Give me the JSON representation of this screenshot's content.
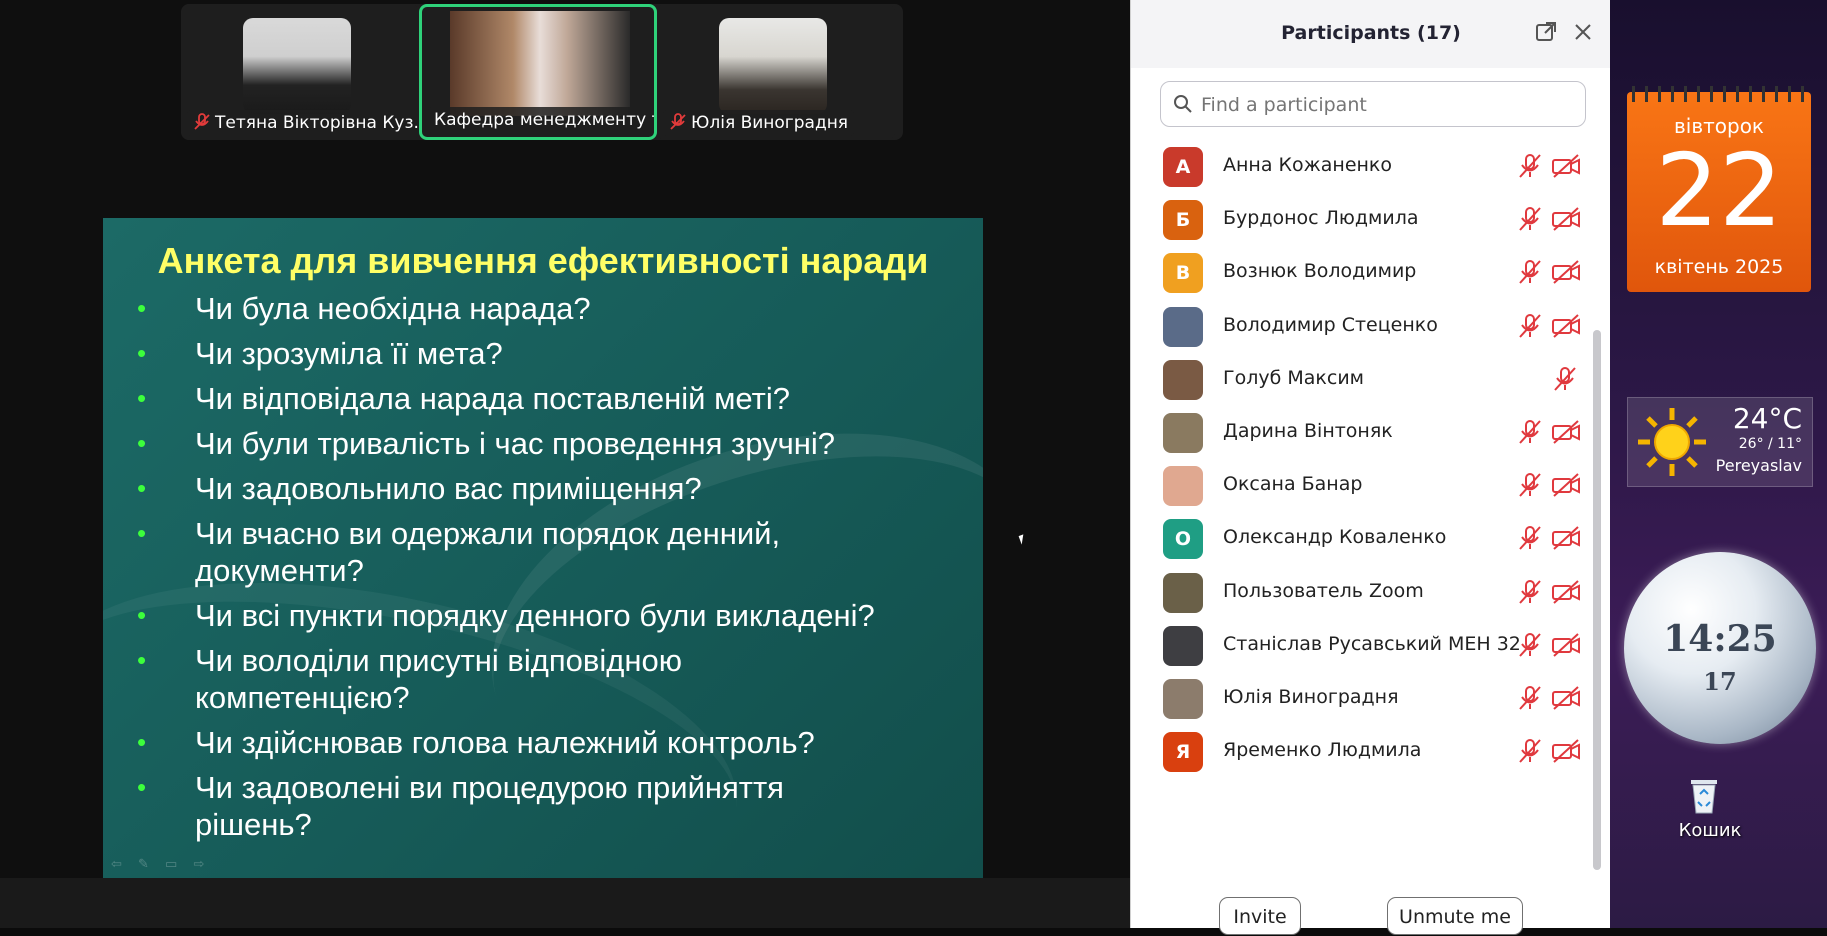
{
  "video_strip": {
    "tiles": [
      {
        "name": "Тетяна Вікторівна Куз...",
        "muted": true
      },
      {
        "name": "Кафедра менеджменту т...",
        "muted": false,
        "active_speaker": true
      },
      {
        "name": "Юлія Виноградня",
        "muted": true
      }
    ]
  },
  "slide": {
    "title": "Анкета для вивчення ефективності наради",
    "bullets": [
      "Чи була необхідна нарада?",
      "Чи зрозуміла її мета?",
      "Чи відповідала нарада поставленій меті?",
      "Чи були тривалість і час проведення зручні?",
      "Чи задовольнило вас приміщення?",
      "Чи вчасно ви одержали порядок денний, документи?",
      "Чи всі пункти порядку денного були викладені?",
      "Чи володіли присутні відповідною компетенцією?",
      "Чи здійснював голова належний контроль?",
      "Чи задоволені ви процедурою прийняття рішень?"
    ]
  },
  "participants": {
    "title": "Participants (17)",
    "search_placeholder": "Find a participant",
    "list": [
      {
        "name": "Анна Кожаненко",
        "initial": "А",
        "color": "#c93a2b",
        "mic_muted": true,
        "video_off": true
      },
      {
        "name": "Бурдонос Людмила",
        "initial": "Б",
        "color": "#d9620f",
        "mic_muted": true,
        "video_off": true
      },
      {
        "name": "Вознюк Володимир",
        "initial": "В",
        "color": "#f0a020",
        "mic_muted": true,
        "video_off": true
      },
      {
        "name": "Володимир Стеценко",
        "initial": "",
        "color": "#5a6b88",
        "mic_muted": true,
        "video_off": true
      },
      {
        "name": "Голуб Максим",
        "initial": "",
        "color": "#7a5a44",
        "mic_muted": true,
        "video_off": false
      },
      {
        "name": "Дарина Вінтоняк",
        "initial": "",
        "color": "#8a7a60",
        "mic_muted": true,
        "video_off": true
      },
      {
        "name": "Оксана Банар",
        "initial": "",
        "color": "#e0a890",
        "mic_muted": true,
        "video_off": true
      },
      {
        "name": "Олександр Коваленко",
        "initial": "О",
        "color": "#1f9e84",
        "mic_muted": true,
        "video_off": true
      },
      {
        "name": "Пользователь Zoom",
        "initial": "",
        "color": "#6a6048",
        "mic_muted": true,
        "video_off": true
      },
      {
        "name": "Станіслав Русавський МЕН 32",
        "initial": "",
        "color": "#3e3e42",
        "mic_muted": true,
        "video_off": true
      },
      {
        "name": "Юлія Виноградня",
        "initial": "",
        "color": "#8c7c6c",
        "mic_muted": true,
        "video_off": true
      },
      {
        "name": "Яременко Людмила",
        "initial": "Я",
        "color": "#d9400f",
        "mic_muted": true,
        "video_off": true
      }
    ],
    "invite_label": "Invite",
    "unmute_label": "Unmute me"
  },
  "desktop": {
    "calendar": {
      "weekday": "вівторок",
      "day": "22",
      "month_year": "квітень 2025"
    },
    "weather": {
      "temp": "24°C",
      "range": "26° / 11°",
      "city": "Pereyaslav"
    },
    "clock": {
      "time": "14:25",
      "seconds": "17"
    },
    "recycle_bin_label": "Кошик"
  }
}
